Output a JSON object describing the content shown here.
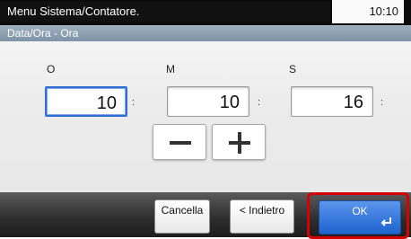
{
  "header": {
    "title": "Menu Sistema/Contatore.",
    "time": "10:10"
  },
  "subheader": {
    "title": "Data/Ora - Ora"
  },
  "fields": [
    {
      "label": "O",
      "value": "10",
      "separator": ":"
    },
    {
      "label": "M",
      "value": "10",
      "separator": ":"
    },
    {
      "label": "S",
      "value": "16",
      "separator": ":"
    }
  ],
  "stepper": {
    "minus_icon": "minus-icon",
    "plus_icon": "plus-icon"
  },
  "footer": {
    "cancel_label": "Cancella",
    "back_label": "< Indietro",
    "ok_label": "OK",
    "ok_icon": "enter-icon"
  },
  "colors": {
    "accent": "#2f6fd3",
    "highlight": "#d40000"
  }
}
